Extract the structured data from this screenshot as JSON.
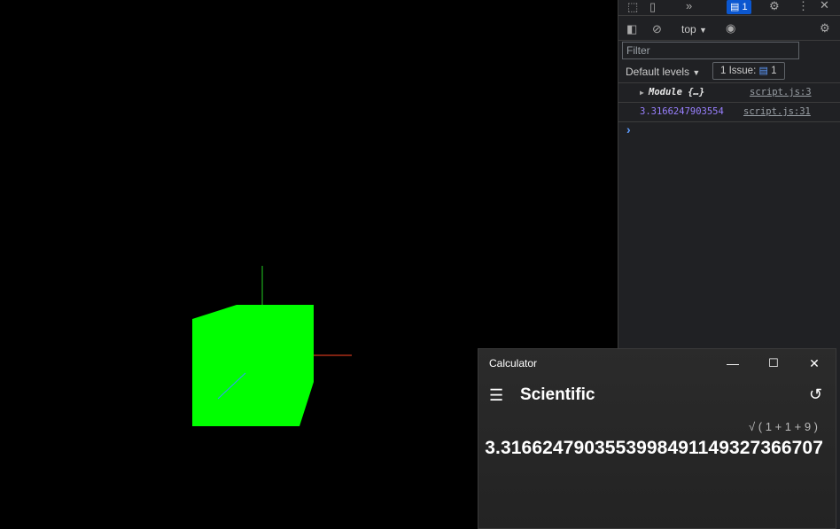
{
  "devtools": {
    "toolbar": {
      "issues_count": "1"
    },
    "console_toolbar": {
      "context": "top"
    },
    "filter": {
      "placeholder": "Filter"
    },
    "levels": {
      "label": "Default levels"
    },
    "issues": {
      "label": "1 Issue:",
      "count": "1"
    },
    "logs": [
      {
        "text": "Module {…}",
        "source": "script.js:3"
      },
      {
        "text": "3.3166247903554",
        "source": "script.js:31"
      }
    ],
    "prompt": "›"
  },
  "calculator": {
    "title": "Calculator",
    "mode": "Scientific",
    "expression": "√ ( 1 + 1 + 9 )",
    "result": "3.3166247903553998491149327366707"
  },
  "colors": {
    "cube": "#00ff00",
    "axis_x": "#ff4422",
    "axis_y": "#22cc22",
    "axis_z": "#3399ff",
    "console_number": "#9980ff",
    "badge": "#0b57d0"
  }
}
